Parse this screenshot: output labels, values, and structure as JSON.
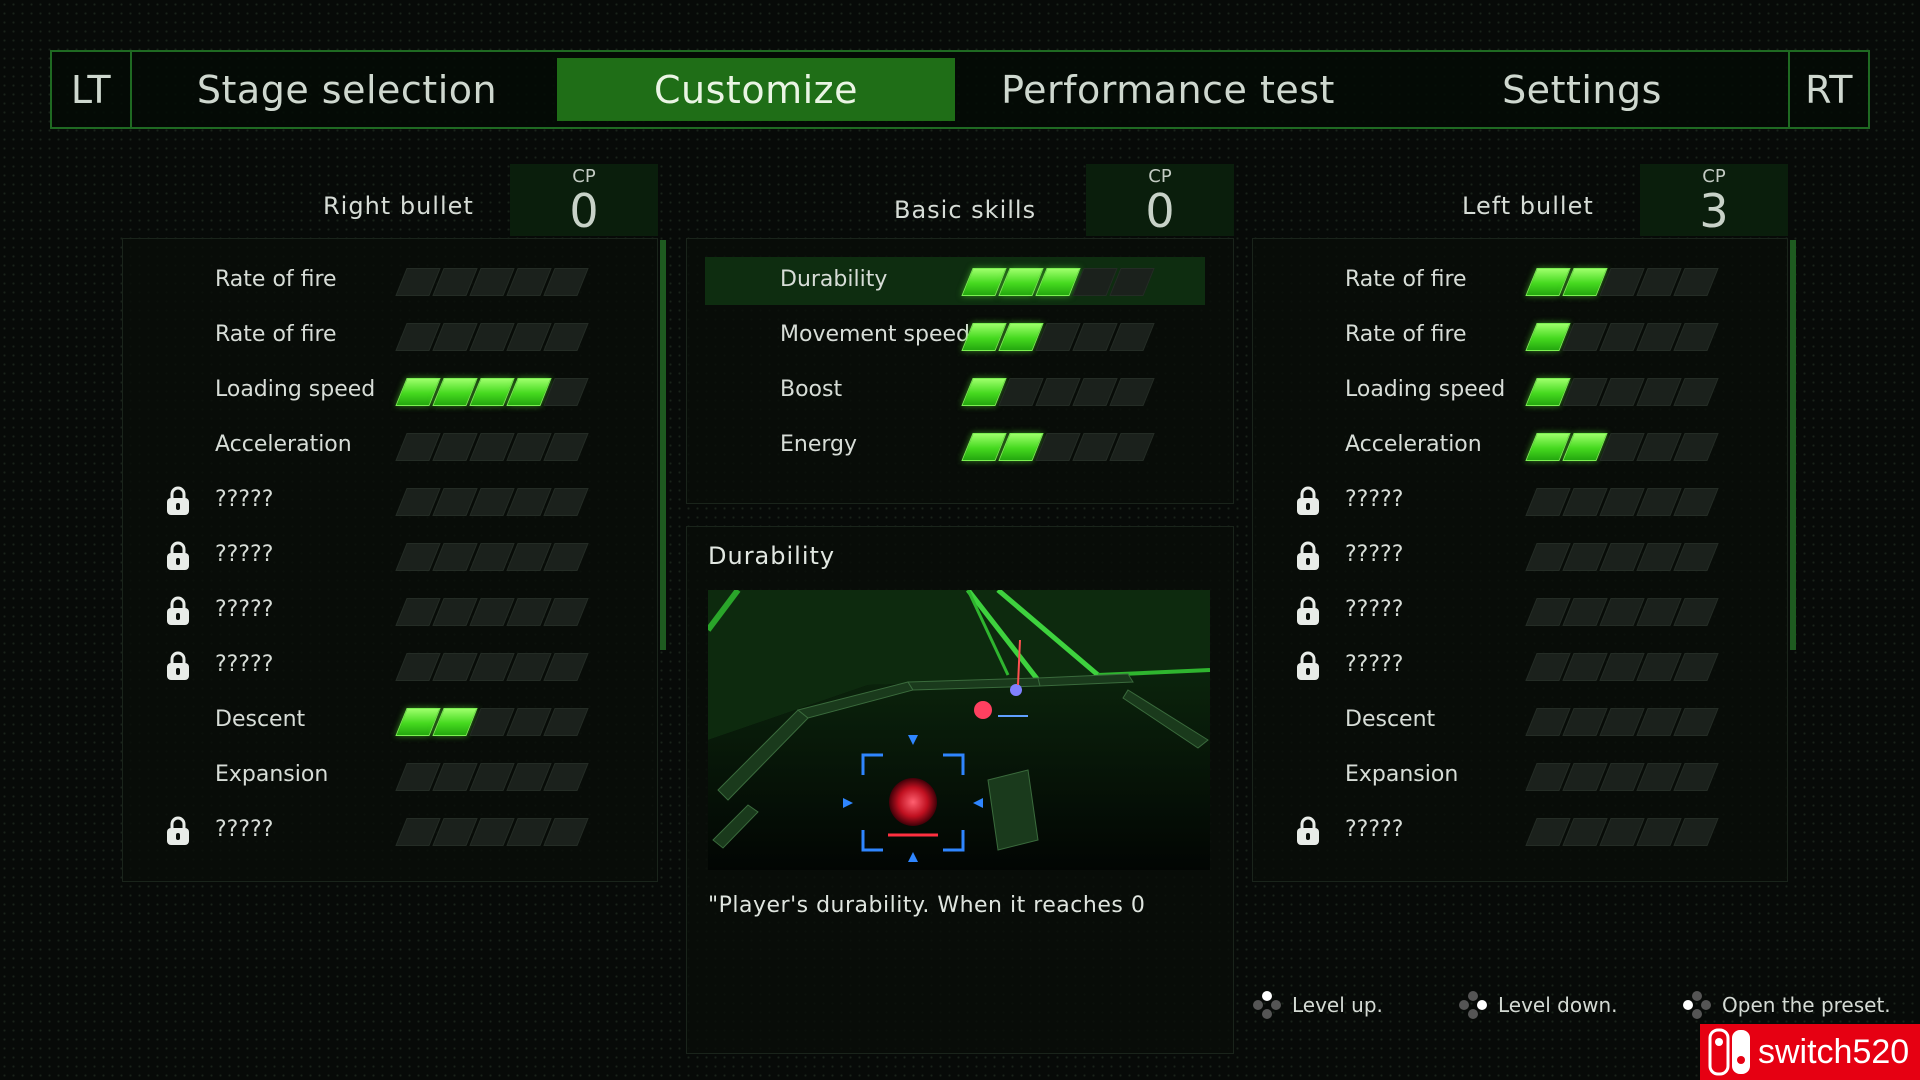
{
  "tabs": {
    "lt": "LT",
    "stage": "Stage selection",
    "customize": "Customize",
    "performance": "Performance test",
    "settings": "Settings",
    "rt": "RT",
    "active": "customize"
  },
  "right_panel": {
    "title": "Right bullet",
    "cp_label": "CP",
    "cp_value": "0",
    "rows": [
      {
        "label": "Rate of fire",
        "level": 0,
        "locked": false
      },
      {
        "label": "Rate of fire",
        "level": 0,
        "locked": false
      },
      {
        "label": "Loading speed",
        "level": 4,
        "locked": false
      },
      {
        "label": "Acceleration",
        "level": 0,
        "locked": false
      },
      {
        "label": "?????",
        "level": 0,
        "locked": true
      },
      {
        "label": "?????",
        "level": 0,
        "locked": true
      },
      {
        "label": "?????",
        "level": 0,
        "locked": true
      },
      {
        "label": "?????",
        "level": 0,
        "locked": true
      },
      {
        "label": "Descent",
        "level": 2,
        "locked": false
      },
      {
        "label": "Expansion",
        "level": 0,
        "locked": false
      },
      {
        "label": "?????",
        "level": 0,
        "locked": true
      }
    ]
  },
  "basic_panel": {
    "title": "Basic skills",
    "cp_label": "CP",
    "cp_value": "0",
    "rows": [
      {
        "label": "Durability",
        "level": 3,
        "locked": false,
        "selected": true
      },
      {
        "label": "Movement speed",
        "level": 2,
        "locked": false
      },
      {
        "label": "Boost",
        "level": 1,
        "locked": false
      },
      {
        "label": "Energy",
        "level": 2,
        "locked": false
      }
    ]
  },
  "left_panel": {
    "title": "Left bullet",
    "cp_label": "CP",
    "cp_value": "3",
    "rows": [
      {
        "label": "Rate of fire",
        "level": 2,
        "locked": false
      },
      {
        "label": "Rate of fire",
        "level": 1,
        "locked": false
      },
      {
        "label": "Loading speed",
        "level": 1,
        "locked": false
      },
      {
        "label": "Acceleration",
        "level": 2,
        "locked": false
      },
      {
        "label": "?????",
        "level": 0,
        "locked": true
      },
      {
        "label": "?????",
        "level": 0,
        "locked": true
      },
      {
        "label": "?????",
        "level": 0,
        "locked": true
      },
      {
        "label": "?????",
        "level": 0,
        "locked": true
      },
      {
        "label": "Descent",
        "level": 0,
        "locked": false
      },
      {
        "label": "Expansion",
        "level": 0,
        "locked": false
      },
      {
        "label": "?????",
        "level": 0,
        "locked": true
      }
    ]
  },
  "info": {
    "title": "Durability",
    "description": "\"Player's durability. When it reaches 0"
  },
  "hints": {
    "level_up": "Level up.",
    "level_down": "Level down.",
    "open_preset": "Open the preset."
  },
  "watermark": {
    "text": "switch520"
  },
  "colors": {
    "accent": "#1f6e17",
    "bar_on": "#45d91f",
    "bar_off": "#1b211c",
    "border": "#1f6a22"
  },
  "max_level": 5
}
